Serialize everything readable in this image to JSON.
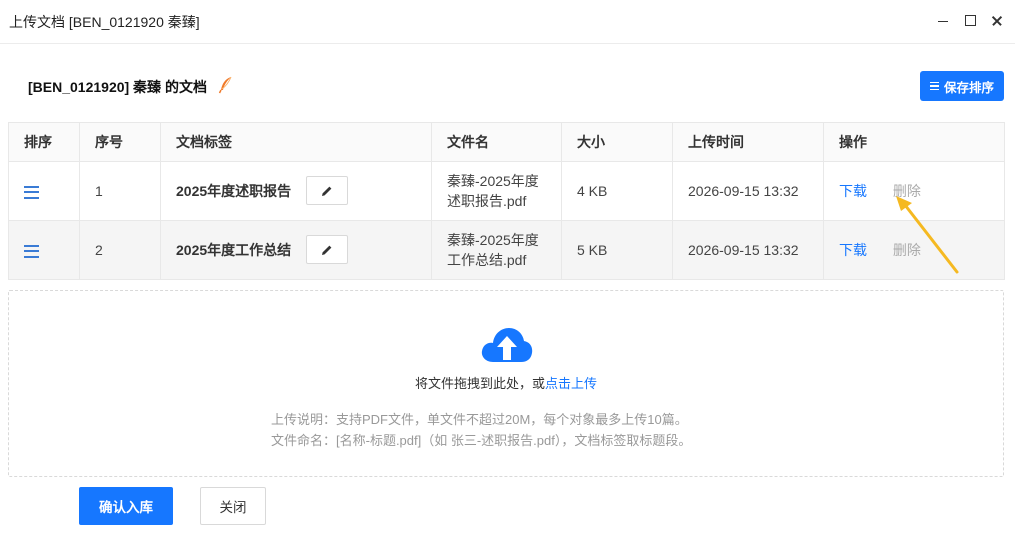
{
  "window": {
    "title": "上传文档 [BEN_0121920 秦臻]"
  },
  "header": {
    "heading": "[BEN_0121920] 秦臻 的文档",
    "save_order_label": "保存排序"
  },
  "table": {
    "columns": [
      "排序",
      "序号",
      "文档标签",
      "文件名",
      "大小",
      "上传时间",
      "操作"
    ],
    "rows": [
      {
        "index": "1",
        "label": "2025年度述职报告",
        "filename_line1": "秦臻-2025年度",
        "filename_line2": "述职报告.pdf",
        "size": "4 KB",
        "uploaded": "2026-09-15 13:32",
        "download": "下载",
        "delete": "删除"
      },
      {
        "index": "2",
        "label": "2025年度工作总结",
        "filename_line1": "秦臻-2025年度",
        "filename_line2": "工作总结.pdf",
        "size": "5 KB",
        "uploaded": "2026-09-15 13:32",
        "download": "下载",
        "delete": "删除"
      }
    ]
  },
  "dropzone": {
    "prompt": "将文件拖拽到此处，或",
    "link": "点击上传",
    "note1": "上传说明：支持PDF文件，单文件不超过20M，每个对象最多上传10篇。",
    "note2": "文件命名：[名称-标题.pdf]（如 张三-述职报告.pdf），文档标签取标题段。"
  },
  "footer": {
    "confirm_label": "确认入库",
    "close_label": "关闭"
  },
  "colors": {
    "primary": "#1677ff",
    "annotation_arrow": "#f5b921",
    "muted": "#aaaaaa"
  },
  "icons": [
    "minimize-icon",
    "maximize-icon",
    "close-icon",
    "feather-icon",
    "menu-icon",
    "drag-handle-icon",
    "pencil-icon",
    "cloud-upload-icon"
  ]
}
